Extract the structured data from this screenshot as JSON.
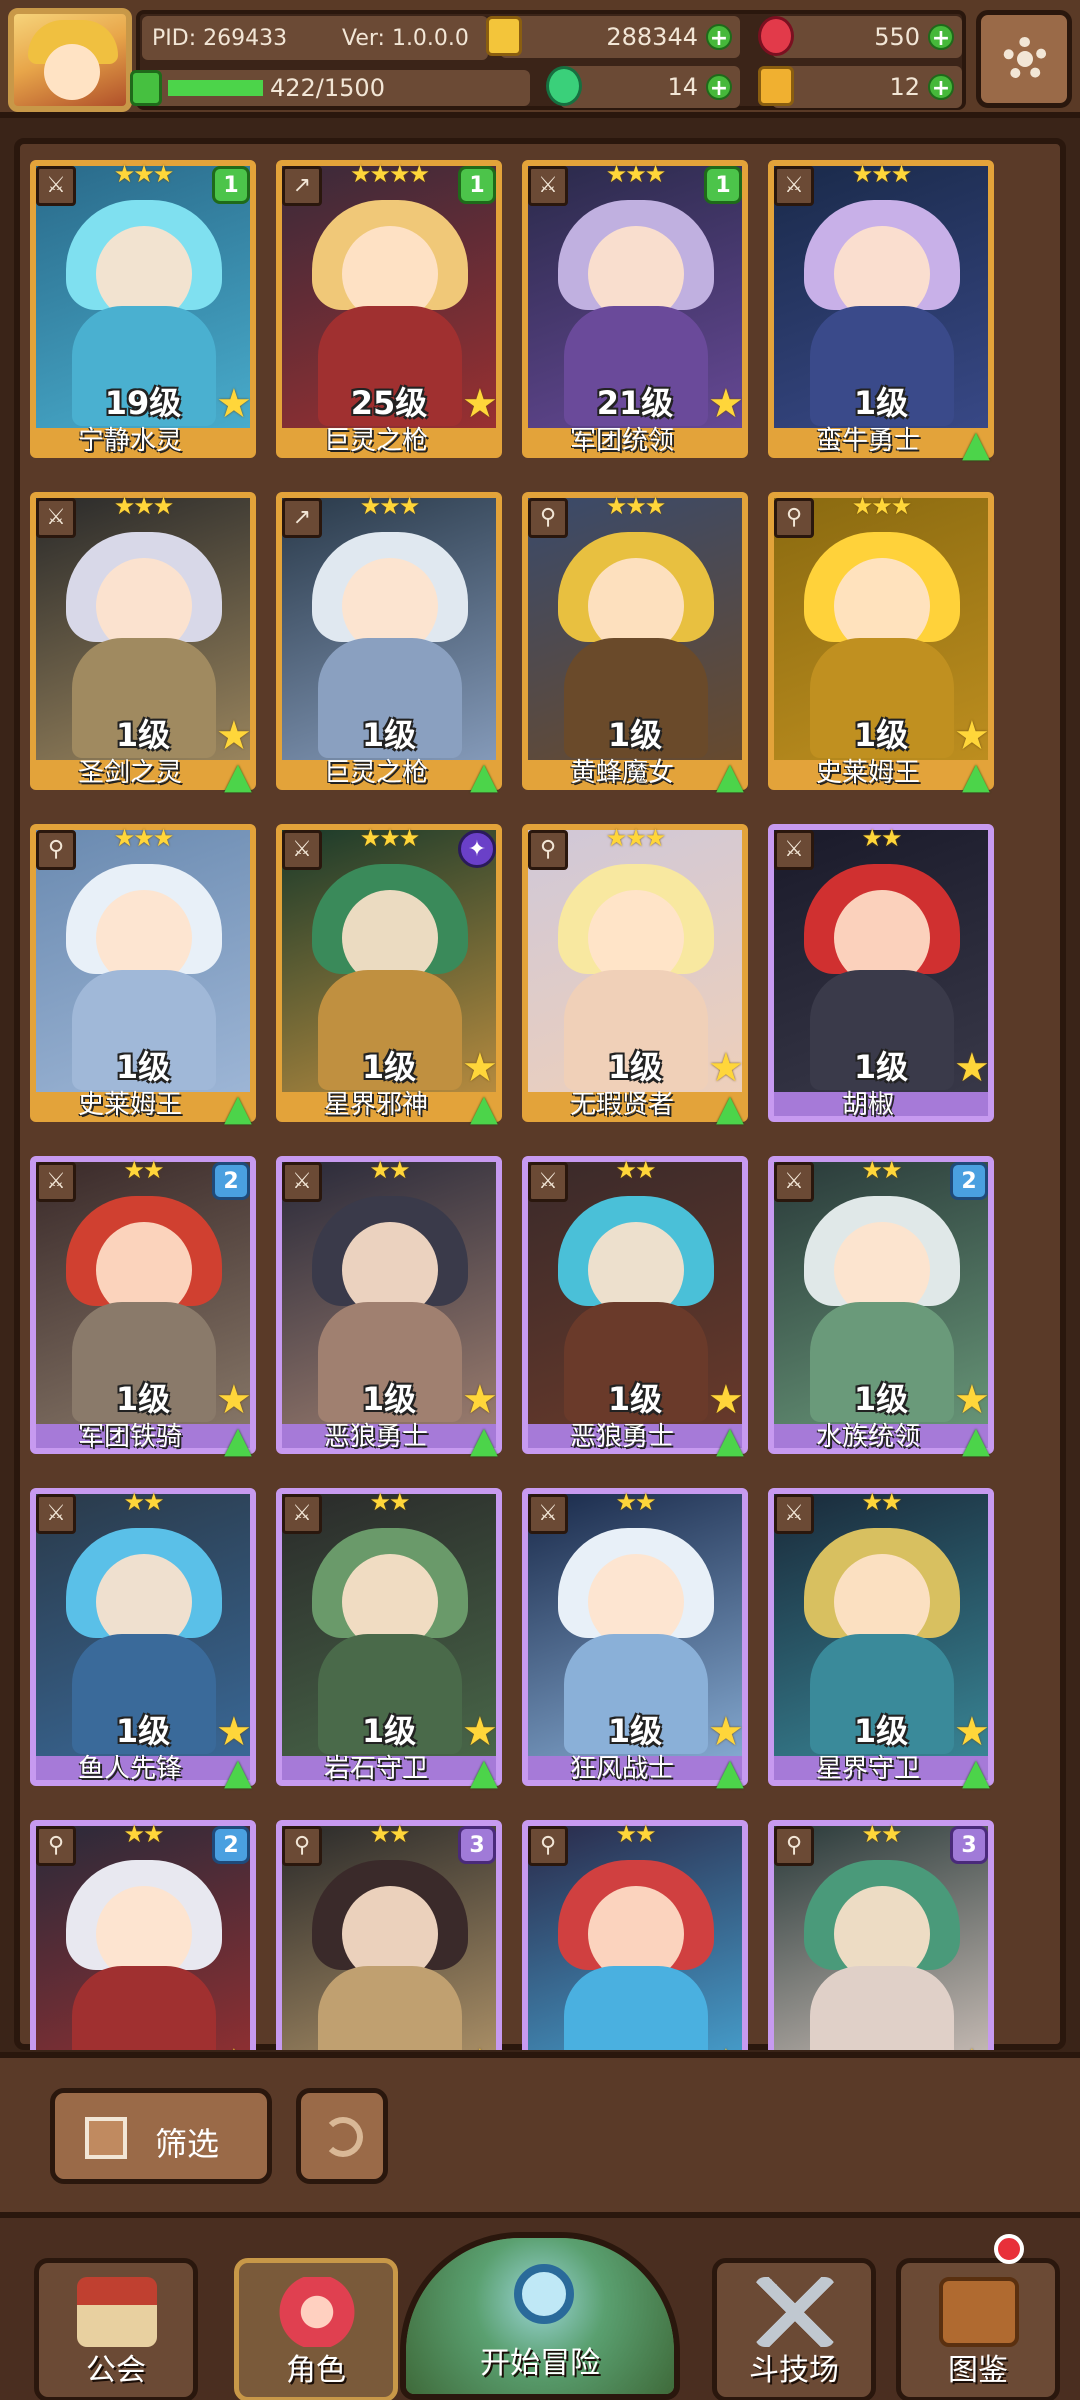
{
  "header": {
    "pid": "PID: 269433",
    "version": "Ver: 1.0.0.0",
    "gold": "288344",
    "gems": "550",
    "clover": "14",
    "keys": "12",
    "xp_text": "422/1500",
    "xp_progress": 0.28,
    "colors": {
      "bg": "#5a3a26",
      "xp": "#4cd44a"
    }
  },
  "cards": [
    {
      "name": "宁静水灵",
      "level": "19级",
      "stars": "★★★",
      "badge": "1",
      "badge_type": "green",
      "rarity": "legendary",
      "palette": [
        "#2a6a8a",
        "#7fe0f0",
        "#4ab0d0"
      ],
      "icon": "sword-icon",
      "extra": "star"
    },
    {
      "name": "巨灵之枪",
      "level": "25级",
      "stars": "★★★★",
      "badge": "1",
      "badge_type": "green",
      "rarity": "legendary",
      "palette": [
        "#3a2a3a",
        "#f0c878",
        "#a03030"
      ],
      "icon": "spear-icon",
      "extra": "star"
    },
    {
      "name": "军团统领",
      "level": "21级",
      "stars": "★★★",
      "badge": "1",
      "badge_type": "green",
      "rarity": "legendary",
      "palette": [
        "#2a2a4a",
        "#c0b0e0",
        "#6a4a9a"
      ],
      "icon": "sword-icon",
      "extra": "star"
    },
    {
      "name": "蛮牛勇士",
      "level": "1级",
      "stars": "★★★",
      "badge": "",
      "badge_type": "",
      "rarity": "legendary",
      "palette": [
        "#1a2a4a",
        "#c8b0e8",
        "#3a4a8a"
      ],
      "icon": "sword-icon",
      "extra": "upgrade"
    },
    {
      "name": "圣剑之灵",
      "level": "1级",
      "stars": "★★★",
      "badge": "",
      "badge_type": "",
      "rarity": "legendary",
      "palette": [
        "#2a2a2a",
        "#d8d8e8",
        "#a08a60"
      ],
      "icon": "sword-icon",
      "extra": "both"
    },
    {
      "name": "巨灵之枪",
      "level": "1级",
      "stars": "★★★",
      "badge": "",
      "badge_type": "",
      "rarity": "legendary",
      "palette": [
        "#2a3a4a",
        "#e0e8f0",
        "#8aa0c0"
      ],
      "icon": "spear-icon",
      "extra": "upgrade"
    },
    {
      "name": "黄蜂魔女",
      "level": "1级",
      "stars": "★★★",
      "badge": "",
      "badge_type": "",
      "rarity": "legendary",
      "palette": [
        "#3a4a6a",
        "#e8c040",
        "#6a4a2a"
      ],
      "icon": "staff-icon",
      "extra": "upgrade"
    },
    {
      "name": "史莱姆王",
      "level": "1级",
      "stars": "★★★",
      "badge": "",
      "badge_type": "",
      "rarity": "legendary",
      "palette": [
        "#8a6a10",
        "#ffd23a",
        "#c09020"
      ],
      "icon": "staff-icon",
      "extra": "both"
    },
    {
      "name": "史莱姆王",
      "level": "1级",
      "stars": "★★★",
      "badge": "",
      "badge_type": "",
      "rarity": "legendary",
      "palette": [
        "#6a8ab0",
        "#e8f0f8",
        "#a0b8d8"
      ],
      "icon": "staff-icon",
      "extra": "upgrade"
    },
    {
      "name": "星界邪神",
      "level": "1级",
      "stars": "★★★",
      "badge": "✦",
      "badge_type": "orb",
      "rarity": "legendary",
      "palette": [
        "#1a3a2a",
        "#3a8a5a",
        "#c09040"
      ],
      "icon": "sword-icon",
      "extra": "both"
    },
    {
      "name": "无瑕贤者",
      "level": "1级",
      "stars": "★★★",
      "badge": "",
      "badge_type": "",
      "rarity": "legendary",
      "palette": [
        "#d0c8d8",
        "#f8e8a0",
        "#f0d0b8"
      ],
      "icon": "staff-icon",
      "extra": "both"
    },
    {
      "name": "胡椒",
      "level": "1级",
      "stars": "★★",
      "badge": "",
      "badge_type": "",
      "rarity": "epic",
      "palette": [
        "#1a1a2a",
        "#d03030",
        "#3a3a4a"
      ],
      "icon": "sword-icon",
      "extra": "star"
    },
    {
      "name": "军团铁骑",
      "level": "1级",
      "stars": "★★",
      "badge": "2",
      "badge_type": "blue",
      "rarity": "epic",
      "palette": [
        "#3a2a2a",
        "#d04030",
        "#8a7a6a"
      ],
      "icon": "sword-icon",
      "extra": "both"
    },
    {
      "name": "恶狼勇士",
      "level": "1级",
      "stars": "★★",
      "badge": "",
      "badge_type": "",
      "rarity": "epic",
      "palette": [
        "#2a2a3a",
        "#3a3a4a",
        "#a08070"
      ],
      "icon": "sword-icon",
      "extra": "both"
    },
    {
      "name": "恶狼勇士",
      "level": "1级",
      "stars": "★★",
      "badge": "",
      "badge_type": "",
      "rarity": "epic",
      "palette": [
        "#3a2a2a",
        "#4ac0d8",
        "#6a3a2a"
      ],
      "icon": "sword-icon",
      "extra": "both"
    },
    {
      "name": "水族统领",
      "level": "1级",
      "stars": "★★",
      "badge": "2",
      "badge_type": "blue",
      "rarity": "epic",
      "palette": [
        "#2a3a3a",
        "#e0e8e8",
        "#6a9a7a"
      ],
      "icon": "sword-icon",
      "extra": "both"
    },
    {
      "name": "鱼人先锋",
      "level": "1级",
      "stars": "★★",
      "badge": "",
      "badge_type": "",
      "rarity": "epic",
      "palette": [
        "#2a3a4a",
        "#5ac0e8",
        "#3a6a9a"
      ],
      "icon": "sword-icon",
      "extra": "both"
    },
    {
      "name": "岩石守卫",
      "level": "1级",
      "stars": "★★",
      "badge": "",
      "badge_type": "",
      "rarity": "epic",
      "palette": [
        "#2a2a2a",
        "#6a9a6a",
        "#4a6a4a"
      ],
      "icon": "sword-icon",
      "extra": "both"
    },
    {
      "name": "狂风战士",
      "level": "1级",
      "stars": "★★",
      "badge": "",
      "badge_type": "",
      "rarity": "epic",
      "palette": [
        "#1a2a4a",
        "#e8f0f8",
        "#8ab0d8"
      ],
      "icon": "sword-icon",
      "extra": "both"
    },
    {
      "name": "星界守卫",
      "level": "1级",
      "stars": "★★",
      "badge": "",
      "badge_type": "",
      "rarity": "epic",
      "palette": [
        "#1a2a3a",
        "#d8c060",
        "#3a8a9a"
      ],
      "icon": "sword-icon",
      "extra": "both"
    },
    {
      "name": "",
      "level": "",
      "stars": "★★",
      "badge": "2",
      "badge_type": "blue",
      "rarity": "epic",
      "palette": [
        "#2a2a3a",
        "#e8e8f0",
        "#a03030"
      ],
      "icon": "staff-icon",
      "extra": "star"
    },
    {
      "name": "",
      "level": "",
      "stars": "★★",
      "badge": "3",
      "badge_type": "purple",
      "rarity": "epic",
      "palette": [
        "#2a2a2a",
        "#3a2a2a",
        "#c0a070"
      ],
      "icon": "staff-icon",
      "extra": "star"
    },
    {
      "name": "",
      "level": "",
      "stars": "★★",
      "badge": "",
      "badge_type": "",
      "rarity": "epic",
      "palette": [
        "#2a2a4a",
        "#d04040",
        "#4ab0e0"
      ],
      "icon": "staff-icon",
      "extra": "star"
    },
    {
      "name": "",
      "level": "",
      "stars": "★★",
      "badge": "3",
      "badge_type": "purple",
      "rarity": "epic",
      "palette": [
        "#2a3a3a",
        "#4a9a7a",
        "#e0d0c8"
      ],
      "icon": "staff-icon",
      "extra": "star"
    }
  ],
  "toolbar": {
    "filter_label": "筛选"
  },
  "nav": {
    "guild": "公会",
    "characters": "角色",
    "adventure": "开始冒险",
    "arena": "斗技场",
    "codex": "图鉴"
  }
}
